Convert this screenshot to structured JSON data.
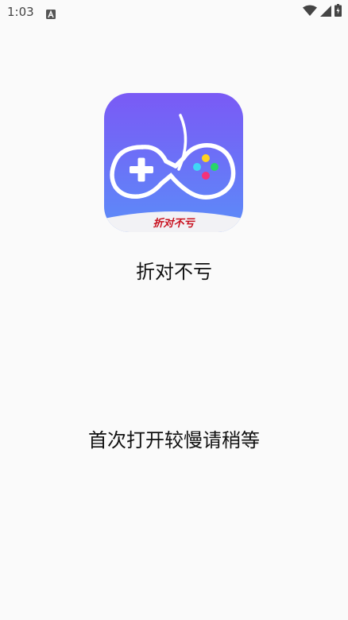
{
  "status_bar": {
    "time": "1:03",
    "notification_icon": "a-letter-icon",
    "wifi_icon": "wifi-icon",
    "signal_icon": "cell-signal-icon",
    "battery_icon": "battery-charging-icon"
  },
  "splash": {
    "icon_badge_text": "折对不亏",
    "app_name": "折对不亏",
    "loading_message": "首次打开较慢请稍等"
  },
  "colors": {
    "background": "#fafafa",
    "icon_gradient_top": "#7a5af5",
    "icon_gradient_bottom": "#5b8df8",
    "badge_text": "#c8101e",
    "dot_yellow": "#ffd21f",
    "dot_cyan": "#3fd7f5",
    "dot_green": "#27d66a",
    "dot_pink": "#f5327a"
  }
}
